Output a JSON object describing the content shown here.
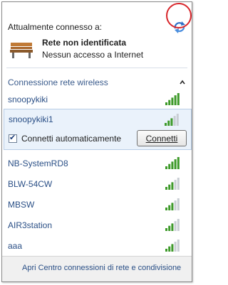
{
  "header": {
    "connected_label": "Attualmente connesso a:"
  },
  "current_network": {
    "title": "Rete non identificata",
    "subtitle": "Nessun accesso a Internet"
  },
  "section": {
    "label": "Connessione rete wireless"
  },
  "selected_network": {
    "name": "snoopykiki1",
    "auto_connect_label": "Connetti automaticamente",
    "auto_connect_checked": true,
    "connect_button": "Connetti"
  },
  "networks": [
    {
      "name": "snoopykiki",
      "signal_bars": 5,
      "secured": false
    },
    {
      "name": "NB-SystemRD8",
      "signal_bars": 5,
      "secured": false
    },
    {
      "name": "BLW-54CW",
      "signal_bars": 3,
      "secured": true
    },
    {
      "name": "MBSW",
      "signal_bars": 3,
      "secured": true
    },
    {
      "name": "AIR3station",
      "signal_bars": 3,
      "secured": true
    },
    {
      "name": "aaa",
      "signal_bars": 3,
      "secured": true
    }
  ],
  "selected_signal_bars": 3,
  "footer": {
    "link": "Apri Centro connessioni di rete e condivisione"
  },
  "colors": {
    "link": "#2a4f86",
    "signal_on": "#3e9a2a",
    "signal_off": "#c9ced4",
    "highlight": "#d8262b"
  }
}
